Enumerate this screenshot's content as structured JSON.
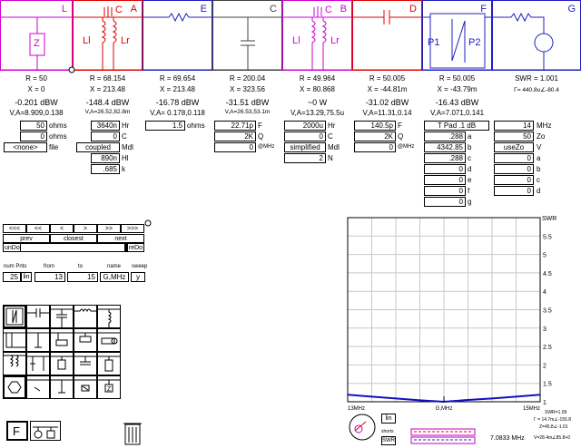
{
  "blocks": [
    {
      "id": "L",
      "color": "#d000d0"
    },
    {
      "id": "A",
      "color": "#e00000"
    },
    {
      "id": "E",
      "color": "#2020c0"
    },
    {
      "id": "C",
      "color": "#404040"
    },
    {
      "id": "B",
      "color": "#d000d0"
    },
    {
      "id": "D",
      "color": "#e00000"
    },
    {
      "id": "F",
      "color": "#2020c0"
    },
    {
      "id": "G",
      "color": "#2020c0"
    }
  ],
  "schematic_labels": {
    "z": "Z",
    "li": "Ll",
    "lr": "Lr",
    "c": "C",
    "li2": "Ll",
    "lr2": "Lr",
    "c2": "C",
    "p1": "P1",
    "p2": "P2"
  },
  "readouts": [
    {
      "r": "R = 50",
      "x": "X = 0",
      "db": "-0.201 dBW",
      "v": "V,A=8.909,0.138"
    },
    {
      "r": "R = 68.154",
      "x": "X = 213.48",
      "db": "-148.4 dBW",
      "v": "V,A=26.52,82.8m"
    },
    {
      "r": "R = 69.654",
      "x": "X = 213.48",
      "db": "-16.78 dBW",
      "v": "V,A= 0.178,0.118"
    },
    {
      "r": "R = 200.04",
      "x": "X = 323.56",
      "db": "-31.51 dBW",
      "v": "V,A=26.53,53.1m"
    },
    {
      "r": "R = 49.964",
      "x": "X = 80.868",
      "db": "~0 W",
      "v": "V,A=13.29,75.5u"
    },
    {
      "r": "R = 50.005",
      "x": "X = -44.81m",
      "db": "-31.02 dBW",
      "v": "V,A=11.31,0.14"
    },
    {
      "r": "R = 50.005",
      "x": "X = -43.79m",
      "db": "-16.43 dBW",
      "v": "V,A=7.071,0.141"
    },
    {
      "r": "SWR = 1.001",
      "x": "Γ= 440.8u∠-80.4",
      "db": "",
      "v": ""
    }
  ],
  "params": {
    "L": {
      "ohms": "50",
      "ohms_lbl": "ohms",
      "x": "0",
      "x_lbl": "ohms",
      "file": "<none>",
      "file_lbl": "file"
    },
    "A": {
      "hr": "3640n",
      "hr_lbl": "Hr",
      "c": "0",
      "c_lbl": "C",
      "mdl": "coupled",
      "mdl_lbl": "Mdl",
      "hl": "890n",
      "hl_lbl": "Hl",
      "k": ".685",
      "k_lbl": "k"
    },
    "E": {
      "ohms": "1.5",
      "ohms_lbl": "ohms"
    },
    "C": {
      "f": "22.71p",
      "f_lbl": "F",
      "q": "2K",
      "q_lbl": "Q",
      "at": "0",
      "at_lbl": "@MHz"
    },
    "B": {
      "hr": "2000u",
      "hr_lbl": "Hr",
      "c": "0",
      "c_lbl": "C",
      "mdl": "simplified",
      "mdl_lbl": "Mdl",
      "n": "2",
      "n_lbl": "N"
    },
    "D": {
      "f": "140.5p",
      "f_lbl": "F",
      "q": "2K",
      "q_lbl": "Q",
      "at": "0",
      "at_lbl": "@MHz"
    },
    "F": {
      "title": "T Pad .1 dB",
      "a": ".288",
      "b": "4342.85",
      "c": ".288",
      "d": "0",
      "e": "0",
      "f": "0",
      "g": "0"
    },
    "G": {
      "mhz": "14",
      "mhz_lbl": "MHz",
      "zo": "50",
      "zo_lbl": "Zo",
      "v": "useZo",
      "v_lbl": "V",
      "a": "0",
      "b": "0",
      "c": "0",
      "d": "0"
    }
  },
  "nav": {
    "arrows": [
      "<<<",
      "<<",
      "<",
      ">",
      ">>",
      ">>>"
    ],
    "prev": "prev",
    "closest": "closest",
    "next": "next",
    "undo": "unDo",
    "redo": "reDo"
  },
  "sweep": {
    "num_pnts_lbl": "num Pnts",
    "from_lbl": "from",
    "to_lbl": "to",
    "name_lbl": "name",
    "sweep_lbl": "sweep",
    "num": "25",
    "lin": "lin",
    "from": "13",
    "to": "15",
    "name": "G,MHz",
    "y": "y"
  },
  "chart_data": {
    "type": "line",
    "title": "",
    "ylabel": "SWR",
    "x": [
      13,
      13.25,
      13.5,
      13.75,
      14,
      14.25,
      14.5,
      14.75,
      15
    ],
    "series": [
      {
        "values": [
          1.19,
          1.14,
          1.09,
          1.04,
          1.0,
          1.05,
          1.09,
          1.14,
          1.19
        ]
      }
    ],
    "xlim": [
      13,
      15
    ],
    "ylim": [
      1,
      6
    ],
    "yticks": [
      "1",
      "1.5",
      "2",
      "2.5",
      "3",
      "3.5",
      "4",
      "4.5",
      "5",
      "5.5"
    ],
    "xtick_labels": [
      "13MHz",
      "G,MHz",
      "15MHz"
    ],
    "grid": true,
    "line_color": "#1010c0"
  },
  "bottom": {
    "lin": "lin",
    "swr_info": "SWR=1.09",
    "g_info": "Γ = 14.7m∠-155.8",
    "z_info": "Z=45.8∠-1.01",
    "v_info": "V=28.4m∠85.8+0",
    "freq": "7.0833 MHz",
    "legend1": "shorts",
    "legend2": "SWR"
  }
}
